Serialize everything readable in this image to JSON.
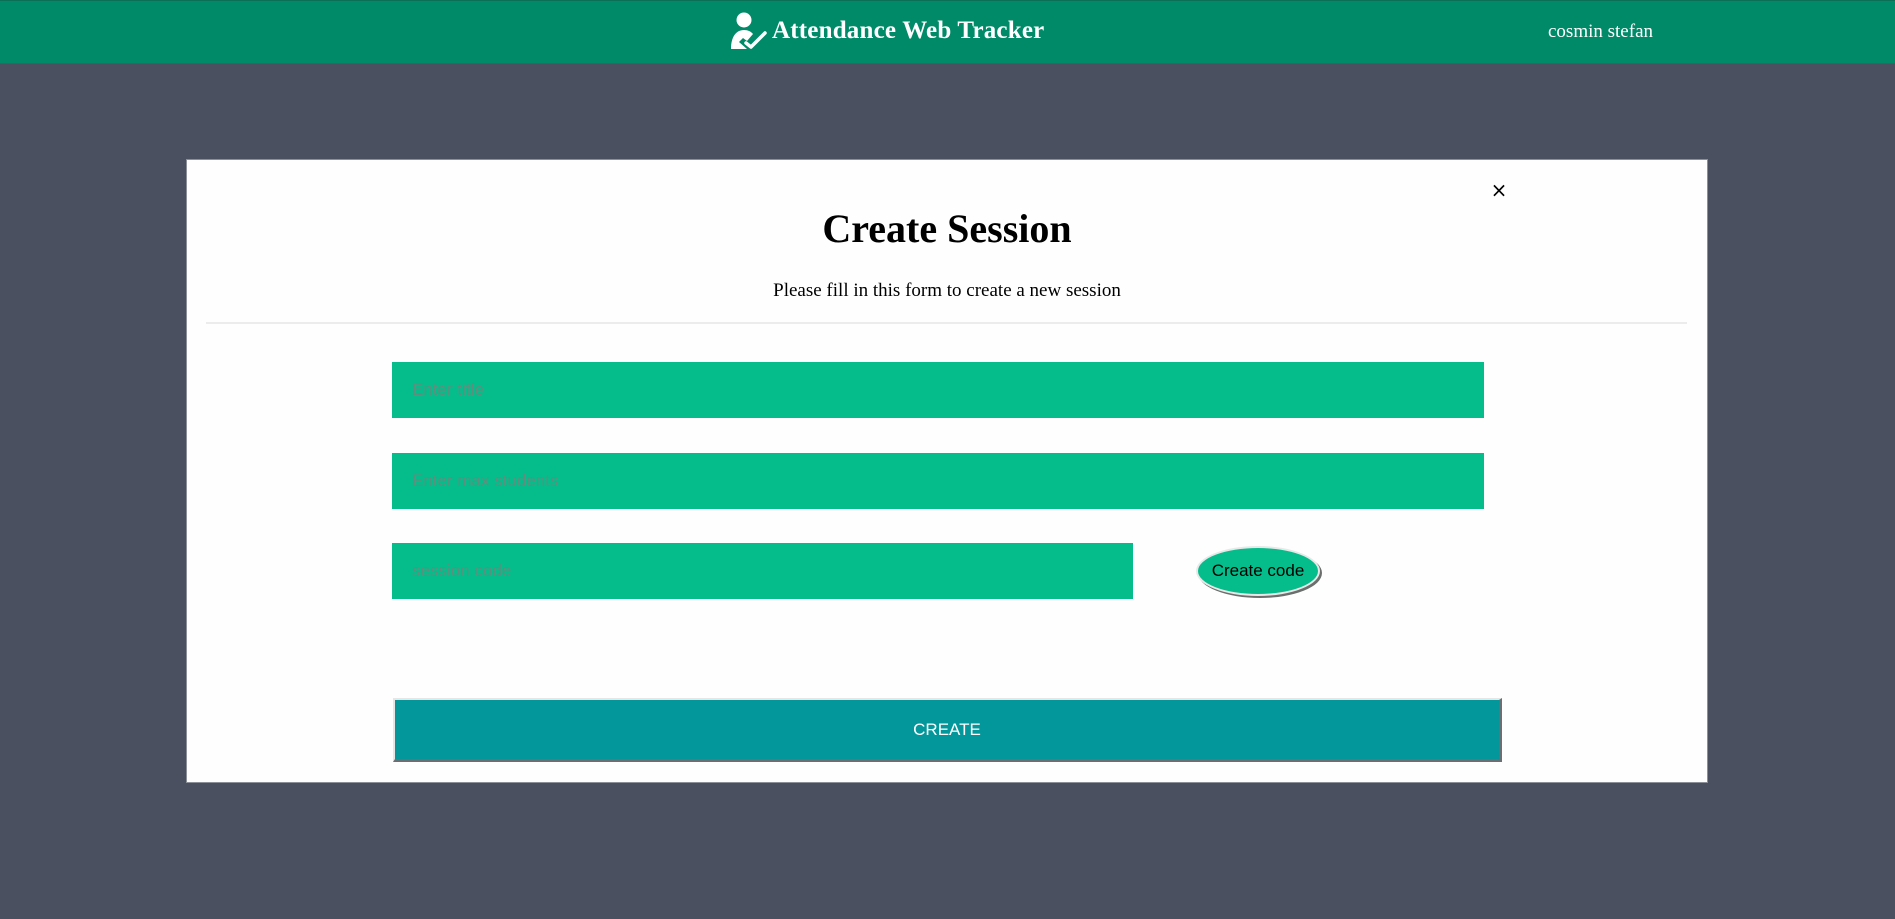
{
  "header": {
    "app_title": "Attendance Web Tracker",
    "app_icon": "user-check-icon",
    "user_name": "cosmin stefan",
    "background_color": "#008a68"
  },
  "modal": {
    "title": "Create Session",
    "subtitle": "Please fill in this form to create a new session",
    "close_label": "×",
    "close_icon": "close-icon",
    "fields": {
      "title": {
        "value": "",
        "placeholder": "Enter title"
      },
      "max_students": {
        "value": "",
        "placeholder": "Enter max students"
      },
      "session_code": {
        "value": "",
        "placeholder": "session code"
      }
    },
    "create_code_label": "Create code",
    "create_label": "CREATE"
  },
  "colors": {
    "page_background": "#4a5060",
    "field_background": "#05bd8a",
    "create_button": "#03979b"
  }
}
